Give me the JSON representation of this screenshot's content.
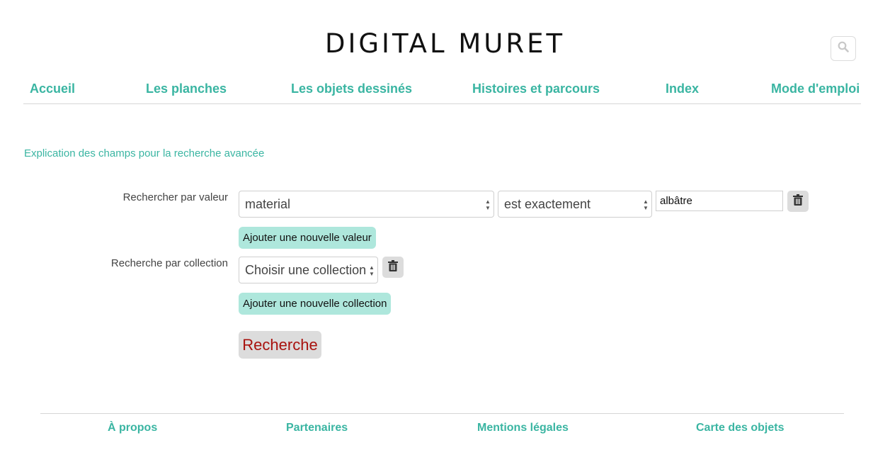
{
  "header": {
    "title": "DIGITAL MURET",
    "search_icon": "search-icon"
  },
  "nav": {
    "items": [
      {
        "label": "Accueil"
      },
      {
        "label": "Les planches"
      },
      {
        "label": "Les objets dessinés"
      },
      {
        "label": "Histoires et parcours"
      },
      {
        "label": "Index"
      },
      {
        "label": "Mode d'emploi"
      }
    ]
  },
  "form": {
    "help_link": "Explication des champs pour la recherche avancée",
    "value_row": {
      "label": "Rechercher par valeur",
      "field_select": "material",
      "operator_select": "est exactement",
      "value_input": "albâtre",
      "add_label": "Ajouter une nouvelle valeur"
    },
    "collection_row": {
      "label": "Recherche par collection",
      "collection_select": "Choisir une collection",
      "add_label": "Ajouter une nouvelle collection"
    },
    "submit_label": "Recherche"
  },
  "footer": {
    "links": [
      {
        "label": "À propos"
      },
      {
        "label": "Partenaires"
      },
      {
        "label": "Mentions légales"
      },
      {
        "label": "Carte des objets"
      }
    ]
  },
  "colors": {
    "accent": "#3ab5a2",
    "add_button_bg": "#aee7dc",
    "submit_text": "#a8120e",
    "button_gray": "#dcdcdc"
  }
}
